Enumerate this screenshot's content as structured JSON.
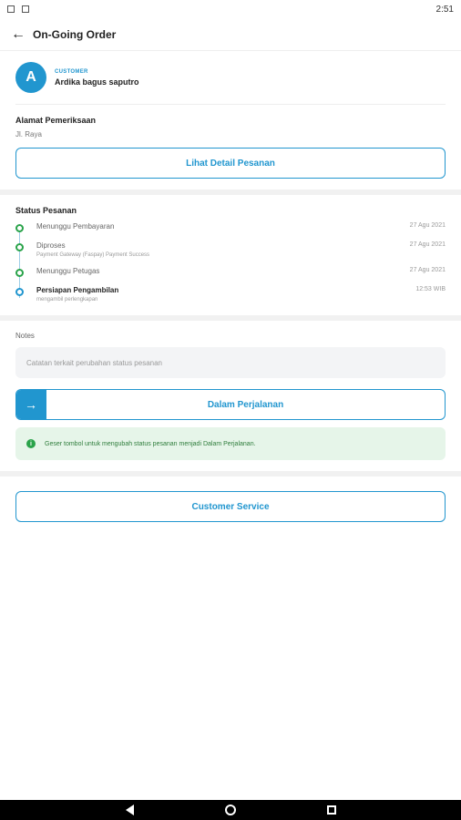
{
  "status_bar": {
    "time": "2:51"
  },
  "app_bar": {
    "title": "On-Going Order"
  },
  "customer": {
    "label": "CUSTOMER",
    "initial": "A",
    "name": "Ardika bagus saputro"
  },
  "address": {
    "title": "Alamat Pemeriksaan",
    "value": "Jl. Raya"
  },
  "detail_button": "Lihat Detail Pesanan",
  "status": {
    "title": "Status Pesanan",
    "items": [
      {
        "label": "Menunggu Pembayaran",
        "date": "27 Agu 2021",
        "sub": ""
      },
      {
        "label": "Diproses",
        "date": "27 Agu 2021",
        "sub": "Payment Gateway (Faspay) Payment Success"
      },
      {
        "label": "Menunggu Petugas",
        "date": "27 Agu 2021",
        "sub": ""
      },
      {
        "label": "Persiapan Pengambilan",
        "date": "12:53 WIB",
        "sub": "mengambil perlengkapan"
      }
    ]
  },
  "notes": {
    "title": "Notes",
    "placeholder": "Catatan terkait perubahan status pesanan"
  },
  "slider": {
    "label": "Dalam Perjalanan"
  },
  "info": {
    "text": "Geser tombol untuk mengubah status pesanan menjadi Dalam Perjalanan."
  },
  "cs_button": "Customer Service",
  "colors": {
    "accent": "#2196cf",
    "success": "#2aa34a",
    "info_bg": "#e6f5e9"
  }
}
